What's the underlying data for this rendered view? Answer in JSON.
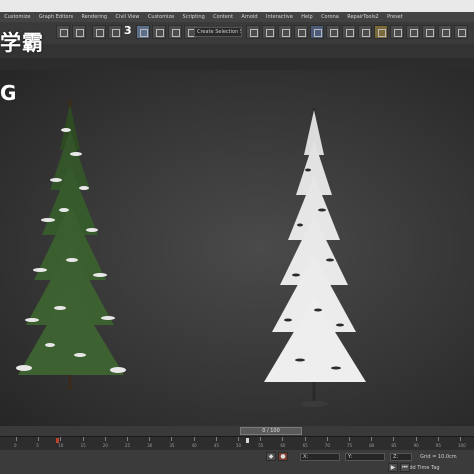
{
  "menu": [
    "Customize",
    "Graph Editors",
    "Rendering",
    "Civil View",
    "Customize",
    "Scripting",
    "Content",
    "Arnold",
    "Interactive",
    "Help",
    "Corona",
    "RepairTools2",
    "Preset"
  ],
  "toolbar": {
    "viewport_number": "3",
    "selection_set_dropdown": "Create Selection Se..."
  },
  "watermark_text": "学霸",
  "viewport": {
    "label": "G"
  },
  "timeline": {
    "frame_display": "0 / 100",
    "tick_labels": [
      "0",
      "5",
      "10",
      "15",
      "20",
      "25",
      "30",
      "35",
      "40",
      "45",
      "50",
      "55",
      "60",
      "65",
      "70",
      "75",
      "80",
      "85",
      "90",
      "95",
      "100"
    ]
  },
  "statusbar": {
    "add_time_tag": "Add Time Tag",
    "grid_readout": "Grid = 10.0cm",
    "x_label": "X:",
    "y_label": "Y:",
    "z_label": "Z:"
  },
  "colors": {
    "ui_dark": "#1e1e1e",
    "menu_bg": "#434343",
    "viewport_center": "#4a4a4a",
    "tree_green": "#3a5a2a",
    "snow": "#f2f2f2",
    "key_red": "#b8442e"
  }
}
